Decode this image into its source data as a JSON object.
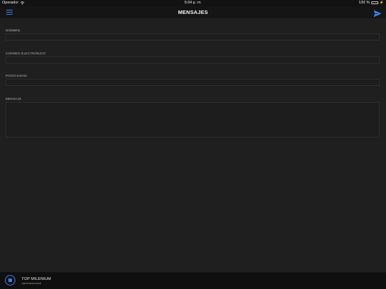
{
  "status_bar": {
    "carrier": "Operador",
    "time": "5:04 p. m.",
    "battery": "100 %",
    "battery_level": 1.0
  },
  "nav": {
    "title": "MENSAJES",
    "menu_icon": "hamburger-menu-icon",
    "send_icon": "paper-plane-send-icon"
  },
  "form": {
    "name_label": "NOMBRE",
    "name_value": "",
    "email_label": "CORREO ELECTRÓNICO",
    "email_value": "",
    "location_label": "PAÍS/CIUDAD",
    "location_value": "",
    "message_label": "MENSAJE",
    "message_value": ""
  },
  "player": {
    "station": "TOP MILENIUM",
    "subtitle": "#generacioncrack",
    "stop_icon": "stop-icon"
  },
  "colors": {
    "accent": "#3a82f7",
    "background": "#1f1f1f",
    "bar_background": "#151515"
  }
}
